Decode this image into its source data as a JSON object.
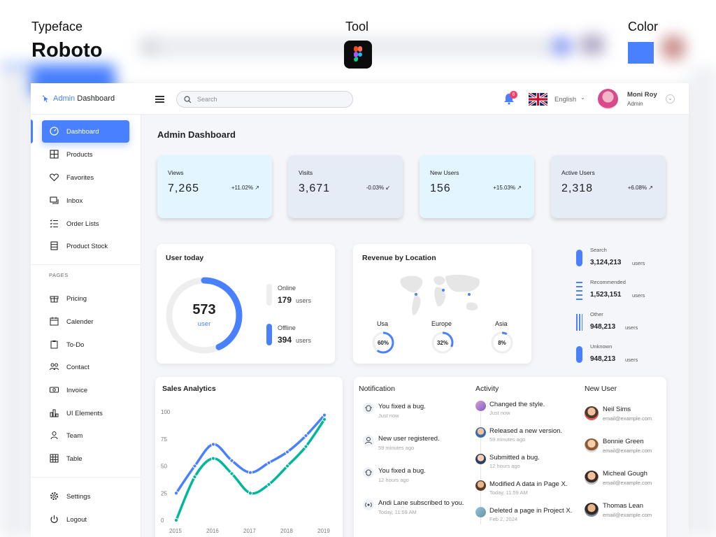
{
  "presentation": {
    "typeface_label": "Typeface",
    "typeface_name": "Roboto",
    "tool_label": "Tool",
    "color_label": "Color",
    "accent_color": "#4880ff"
  },
  "header": {
    "logo_accent": "Admin",
    "logo_rest": " Dashboard",
    "search_placeholder": "Search",
    "notification_count": "6",
    "language": "English",
    "user_name": "Moni Roy",
    "user_role": "Admin"
  },
  "sidebar": {
    "items": [
      {
        "label": "Dashboard",
        "icon": "gauge-icon",
        "active": true
      },
      {
        "label": "Products",
        "icon": "grid-icon"
      },
      {
        "label": "Favorites",
        "icon": "heart-icon"
      },
      {
        "label": "Inbox",
        "icon": "inbox-icon"
      },
      {
        "label": "Order Lists",
        "icon": "list-check-icon"
      },
      {
        "label": "Product Stock",
        "icon": "stock-icon"
      }
    ],
    "pages_label": "PAGES",
    "pages": [
      {
        "label": "Pricing",
        "icon": "gift-icon"
      },
      {
        "label": "Calender",
        "icon": "calendar-icon"
      },
      {
        "label": "To-Do",
        "icon": "clipboard-icon"
      },
      {
        "label": "Contact",
        "icon": "users-icon"
      },
      {
        "label": "Invoice",
        "icon": "invoice-icon"
      },
      {
        "label": "UI Elements",
        "icon": "chart-bars-icon"
      },
      {
        "label": "Team",
        "icon": "user-icon"
      },
      {
        "label": "Table",
        "icon": "table-icon"
      }
    ],
    "bottom": [
      {
        "label": "Settings",
        "icon": "gear-icon"
      },
      {
        "label": "Logout",
        "icon": "power-icon"
      }
    ]
  },
  "main": {
    "title": "Admin Dashboard",
    "stats": [
      {
        "title": "Views",
        "value": "7,265",
        "change": "+11.02%",
        "trend": "up",
        "bg": "#e3f5ff"
      },
      {
        "title": "Visits",
        "value": "3,671",
        "change": "-0.03%",
        "trend": "down",
        "bg": "#e5ecf6"
      },
      {
        "title": "New Users",
        "value": "156",
        "change": "+15.03%",
        "trend": "up",
        "bg": "#e3f5ff"
      },
      {
        "title": "Active Users",
        "value": "2,318",
        "change": "+6.08%",
        "trend": "up",
        "bg": "#e5ecf6"
      }
    ],
    "user_today": {
      "title": "User today",
      "total": "573",
      "total_label": "user",
      "online_label": "Online",
      "online_value": "179",
      "offline_label": "Offline",
      "offline_value": "394",
      "unit": "users",
      "offline_fraction": 0.43
    },
    "revenue": {
      "title": "Revenue by Location",
      "regions": [
        {
          "name": "Usa",
          "pct": "60%",
          "value": 0.6
        },
        {
          "name": "Europe",
          "pct": "32%",
          "value": 0.32
        },
        {
          "name": "Asia",
          "pct": "8%",
          "value": 0.08
        }
      ]
    },
    "sources": [
      {
        "label": "Search",
        "value": "3,124,213",
        "unit": "users"
      },
      {
        "label": "Recommended",
        "value": "1,523,151",
        "unit": "users"
      },
      {
        "label": "Other",
        "value": "948,213",
        "unit": "users"
      },
      {
        "label": "Unknown",
        "value": "948,213",
        "unit": "users"
      }
    ],
    "sales": {
      "title": "Sales Analytics"
    },
    "notifications": {
      "title": "Notification",
      "items": [
        {
          "text": "You fixed a bug.",
          "time": "Just now",
          "icon": "bug-icon"
        },
        {
          "text": "New user registered.",
          "time": "59 minutes ago",
          "icon": "user-icon"
        },
        {
          "text": "You fixed a bug.",
          "time": "12 hours ago",
          "icon": "bug-icon"
        },
        {
          "text": "Andi Lane subscribed to you.",
          "time": "Today, 11:59 AM",
          "icon": "broadcast-icon"
        }
      ]
    },
    "activity": {
      "title": "Activity",
      "items": [
        {
          "text": "Changed the style.",
          "time": "Just now"
        },
        {
          "text": "Released a new version.",
          "time": "59 minutes ago"
        },
        {
          "text": "Submitted a bug.",
          "time": "12 hours ago"
        },
        {
          "text": "Modified A data in Page X.",
          "time": "Today, 11:59 AM"
        },
        {
          "text": "Deleted a page in Project X.",
          "time": "Feb 2, 2024"
        }
      ]
    },
    "new_users": {
      "title": "New User",
      "items": [
        {
          "name": "Neil Sims",
          "email": "email@example.com"
        },
        {
          "name": "Bonnie Green",
          "email": "email@example.com"
        },
        {
          "name": "Micheal Gough",
          "email": "email@example.com"
        },
        {
          "name": "Thomas Lean",
          "email": "email@example.com"
        }
      ]
    }
  },
  "chart_data": {
    "type": "line",
    "title": "Sales Analytics",
    "x": [
      2015,
      2015.5,
      2016,
      2016.5,
      2017,
      2017.5,
      2018,
      2018.5,
      2019
    ],
    "x_ticks": [
      "2015",
      "2016",
      "2017",
      "2018",
      "2019"
    ],
    "y_ticks": [
      "0",
      "25",
      "50",
      "75",
      "100"
    ],
    "ylim": [
      0,
      100
    ],
    "series": [
      {
        "color": "#4880ff",
        "values": [
          25,
          50,
          70,
          55,
          44,
          53,
          63,
          78,
          97
        ]
      },
      {
        "color": "#00b69b",
        "values": [
          0,
          40,
          57,
          43,
          25,
          33,
          50,
          68,
          93
        ]
      }
    ]
  }
}
